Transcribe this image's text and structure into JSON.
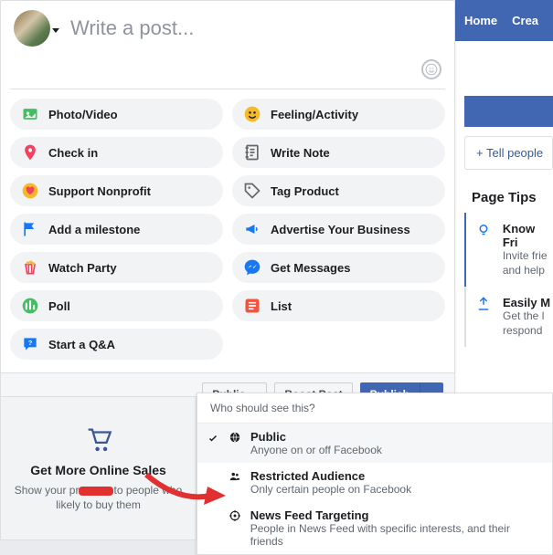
{
  "nav": {
    "home": "Home",
    "create": "Crea"
  },
  "sidebar": {
    "tell": "+ Tell people",
    "tips_header": "Page Tips",
    "tips": [
      {
        "title": "Know Fri",
        "sub1": "Invite frie",
        "sub2": "and help"
      },
      {
        "title": "Easily M",
        "sub1": "Get the l",
        "sub2": "respond"
      }
    ]
  },
  "compose": {
    "placeholder": "Write a post..."
  },
  "options": [
    {
      "key": "photo-video",
      "label": "Photo/Video"
    },
    {
      "key": "feeling",
      "label": "Feeling/Activity"
    },
    {
      "key": "checkin",
      "label": "Check in"
    },
    {
      "key": "note",
      "label": "Write Note"
    },
    {
      "key": "nonprofit",
      "label": "Support Nonprofit"
    },
    {
      "key": "tag-product",
      "label": "Tag Product"
    },
    {
      "key": "milestone",
      "label": "Add a milestone"
    },
    {
      "key": "advertise",
      "label": "Advertise Your Business"
    },
    {
      "key": "watch-party",
      "label": "Watch Party"
    },
    {
      "key": "messages",
      "label": "Get Messages"
    },
    {
      "key": "poll",
      "label": "Poll"
    },
    {
      "key": "list",
      "label": "List"
    },
    {
      "key": "qa",
      "label": "Start a Q&A"
    }
  ],
  "footer": {
    "audience": "Public",
    "boost": "Boost Post",
    "publish": "Publish"
  },
  "dropdown": {
    "header": "Who should see this?",
    "items": [
      {
        "title": "Public",
        "sub": "Anyone on or off Facebook",
        "selected": true
      },
      {
        "title": "Restricted Audience",
        "sub": "Only certain people on Facebook",
        "selected": false
      },
      {
        "title": "News Feed Targeting",
        "sub": "People in News Feed with specific interests, and their friends",
        "selected": false
      }
    ]
  },
  "promo": {
    "title": "Get More Online Sales",
    "sub_a": "Show your pr",
    "sub_b": "to people who",
    "sub_c": "likely to buy them"
  },
  "icons": {
    "colors": {
      "green": "#45bd62",
      "yellow": "#f7b928",
      "red": "#f3425f",
      "blue": "#1877f2",
      "orange": "#f5533d",
      "teal": "#009688",
      "gray": "#65676b"
    }
  }
}
